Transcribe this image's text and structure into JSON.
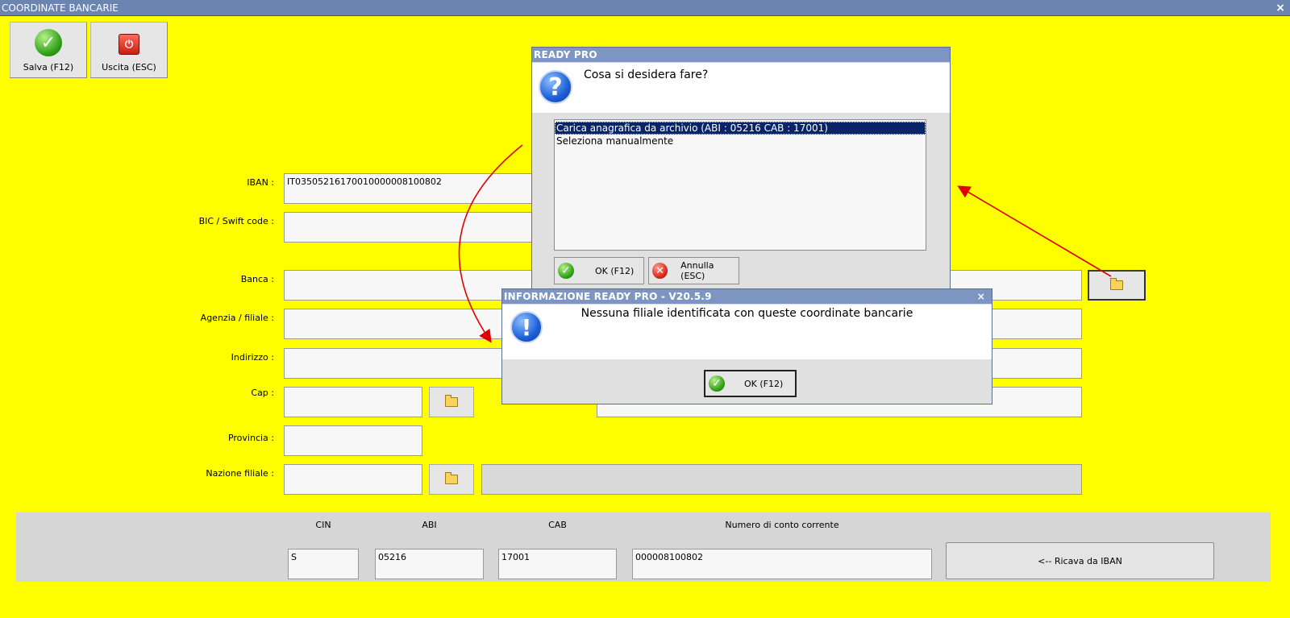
{
  "window": {
    "title": "COORDINATE BANCARIE",
    "close_glyph": "×"
  },
  "toolbar": {
    "save_label": "Salva (F12)",
    "exit_label": "Uscita (ESC)",
    "save_icon": "check-icon",
    "exit_icon": "power-icon"
  },
  "form": {
    "iban_label": "IBAN :",
    "iban_value": "IT03505216170010000008100802",
    "bic_label": "BIC / Swift code :",
    "bic_value": "",
    "banca_label": "Banca :",
    "banca_value": "",
    "agenzia_label": "Agenzia / filiale :",
    "agenzia_value": "",
    "indirizzo_label": "Indirizzo :",
    "indirizzo_value": "",
    "cap_label": "Cap :",
    "cap_value": "",
    "provincia_label": "Provincia :",
    "provincia_value": "",
    "nazione_label": "Nazione filiale :",
    "nazione_value": ""
  },
  "bottom": {
    "cin_label": "CIN",
    "abi_label": "ABI",
    "cab_label": "CAB",
    "conto_label": "Numero di conto corrente",
    "cin_value": "S",
    "abi_value": "05216",
    "cab_value": "17001",
    "conto_value": "000008100802",
    "ricava_label": "<-- Ricava da IBAN"
  },
  "dialog_choice": {
    "title": "READY PRO",
    "question": "Cosa si desidera fare?",
    "icon_glyph": "?",
    "options": [
      "Carica anagrafica da archivio (ABI : 05216 CAB : 17001)",
      "Seleziona manualmente"
    ],
    "ok_label": "OK (F12)",
    "cancel_label": "Annulla (ESC)"
  },
  "dialog_info": {
    "title": "INFORMAZIONE READY PRO - V20.5.9",
    "message": "Nessuna filiale identificata con queste coordinate bancarie",
    "icon_glyph": "!",
    "ok_label": "OK (F12)",
    "close_glyph": "×"
  },
  "colors": {
    "background": "#ffff00",
    "titlebar": "#6b84b0",
    "selection": "#0a246a",
    "annotation_arrow": "#e00000"
  }
}
